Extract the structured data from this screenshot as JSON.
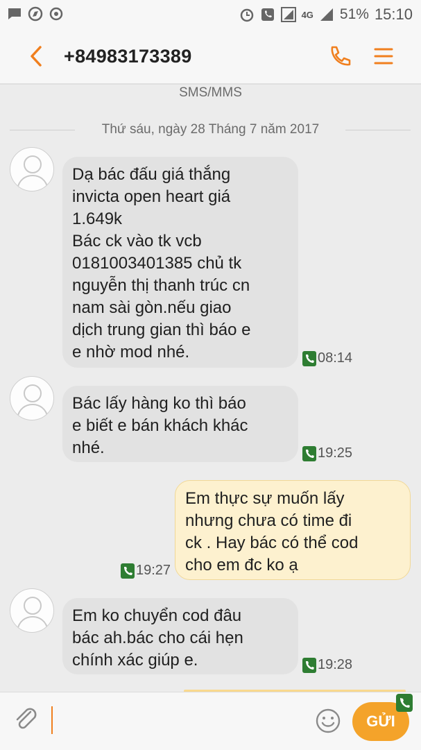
{
  "status_bar": {
    "battery": "51%",
    "time": "15:10",
    "network": "4G"
  },
  "header": {
    "contact": "+84983173389"
  },
  "thread": {
    "channel_label": "SMS/MMS",
    "date_label": "Thứ sáu, ngày 28 Tháng 7 năm 2017",
    "messages": [
      {
        "direction": "in",
        "text": "Dạ bác đấu giá thắng\ninvicta open heart giá\n1.649k\nBác ck vào tk vcb\n0181003401385 chủ tk\nnguyễn thị thanh trúc cn\nnam sài gòn.nếu giao\ndịch trung gian thì báo e\ne nhờ mod nhé.",
        "time": "08:14"
      },
      {
        "direction": "in",
        "text": "Bác lấy hàng ko thì báo\ne biết e bán khách khác\nnhé.",
        "time": "19:25"
      },
      {
        "direction": "out",
        "text": "Em thực sự muốn lấy\nnhưng chưa có time đi\nck . Hay bác có thể cod\ncho em đc ko ạ",
        "time": "19:27"
      },
      {
        "direction": "in",
        "text": "Em ko chuyển cod đâu\nbác ah.bác cho cái hẹn\nchính xác giúp e.",
        "time": "19:28"
      }
    ]
  },
  "compose": {
    "send_label": "GỬI",
    "input_value": ""
  },
  "colors": {
    "accent": "#f07f1e",
    "send": "#f4a32a",
    "incoming_bubble": "#e2e2e2",
    "outgoing_bubble": "#fdf1cf",
    "phone_badge": "#2e7d32"
  },
  "icons": [
    "message-icon",
    "compass-icon",
    "sync-icon",
    "alarm-icon",
    "phone-call-icon",
    "signal-icon",
    "back-arrow-icon",
    "phone-icon",
    "menu-icon",
    "paperclip-icon",
    "emoji-icon"
  ]
}
